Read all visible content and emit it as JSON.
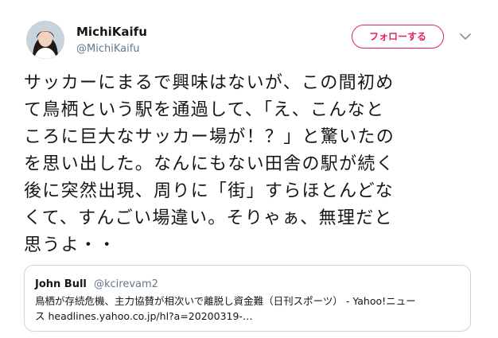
{
  "author": {
    "display_name": "MichiKaifu",
    "handle": "@MichiKaifu",
    "follow_label": "フォローする"
  },
  "tweet": {
    "lines": [
      "サッカーにまるで興味はないが、この間初め",
      "て鳥栖という駅を通過して、「え、こんなと",
      "ころに巨大なサッカー場が！？」と驚いたの",
      "を思い出した。なんにもない田舎の駅が続く",
      "後に突然出現、周りに「街」すらほとんどな",
      "くて、すんごい場違い。そりゃぁ、無理だと",
      "思うよ・・"
    ]
  },
  "quote": {
    "display_name": "John Bull",
    "handle": "@kcirevam2",
    "lines": [
      "鳥栖が存続危機、主力協賛が相次いで離脱し資金難（日刊スポーツ） - Yahoo!ニュー",
      "ス headlines.yahoo.co.jp/hl?a=20200319-…"
    ]
  },
  "colors": {
    "follow_accent": "#e0245e",
    "secondary_text": "#657786",
    "border": "#ccd6dd"
  },
  "icons": {
    "menu": "chevron-down-icon",
    "avatar": "avatar"
  }
}
